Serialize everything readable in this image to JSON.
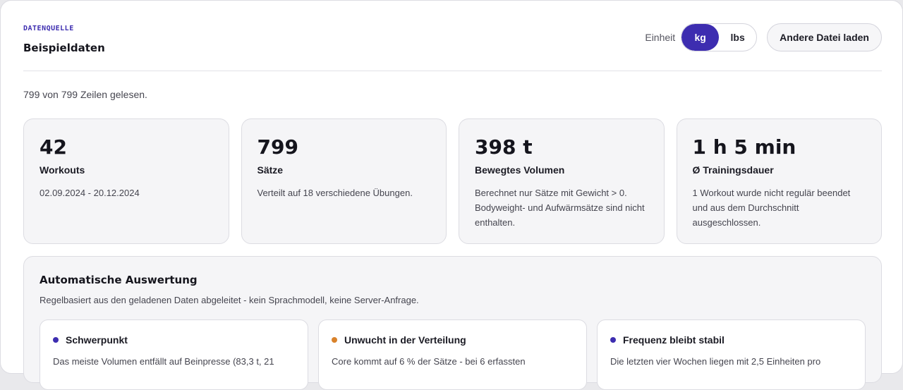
{
  "header": {
    "source_label": "DATENQUELLE",
    "source_name": "Beispieldaten",
    "unit_label": "Einheit",
    "unit_options": [
      "kg",
      "lbs"
    ],
    "unit_selected": "kg",
    "load_button": "Andere Datei laden"
  },
  "rows_info": "799 von 799 Zeilen gelesen.",
  "stats": [
    {
      "value": "42",
      "label": "Workouts",
      "desc": "02.09.2024 - 20.12.2024"
    },
    {
      "value": "799",
      "label": "Sätze",
      "desc": "Verteilt auf 18 verschiedene Übungen."
    },
    {
      "value": "398 t",
      "label": "Bewegtes Volumen",
      "desc": "Berechnet nur Sätze mit Gewicht > 0. Bodyweight- und Aufwärmsätze sind nicht enthalten."
    },
    {
      "value": "1 h 5 min",
      "label": "Ø Trainingsdauer",
      "desc": "1 Workout wurde nicht regulär beendet und aus dem Durchschnitt ausgeschlossen."
    }
  ],
  "analysis": {
    "title": "Automatische Auswertung",
    "subtitle": "Regelbasiert aus den geladenen Daten abgeleitet - kein Sprachmodell, keine Server-Anfrage.",
    "insights": [
      {
        "title": "Schwerpunkt",
        "text": "Das meiste Volumen entfällt auf Beinpresse (83,3 t, 21",
        "color": "#3d2db0"
      },
      {
        "title": "Unwucht in der Verteilung",
        "text": "Core kommt auf 6 % der Sätze - bei 6 erfassten",
        "color": "#d9822b"
      },
      {
        "title": "Frequenz bleibt stabil",
        "text": "Die letzten vier Wochen liegen mit 2,5 Einheiten pro",
        "color": "#3d2db0"
      }
    ]
  }
}
